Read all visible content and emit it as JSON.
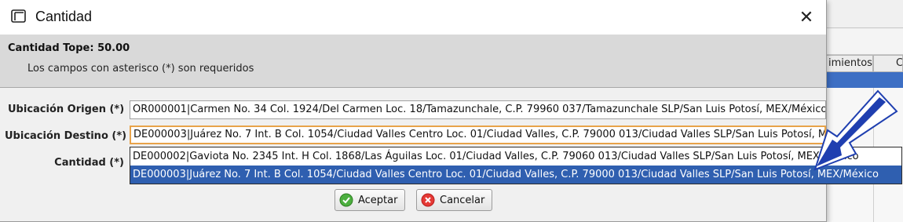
{
  "background_window": {
    "column_headers": [
      "imientos",
      "C"
    ]
  },
  "dialog": {
    "title": "Cantidad",
    "close_label": "✕",
    "header": {
      "cantidad_tope": "Cantidad Tope: 50.00",
      "required_note": "Los campos con asterisco (*) son requeridos"
    },
    "form": {
      "origen_label": "Ubicación Origen (*)",
      "origen_value": "OR000001|Carmen No. 34 Col. 1924/Del Carmen Loc. 18/Tamazunchale, C.P. 79960 037/Tamazunchale SLP/San Luis Potosí, MEX/México",
      "destino_label": "Ubicación Destino (*)",
      "destino_value": "DE000003|Juárez No. 7 Int. B Col. 1054/Ciudad Valles Centro Loc. 01/Ciudad Valles, C.P. 79000 013/Ciudad Valles SLP/San Luis Potosí, MEX/México",
      "cantidad_label": "Cantidad (*)"
    },
    "dropdown_options": [
      "DE000002|Gaviota No. 2345 Int. H Col. 1868/Las Águilas Loc. 01/Ciudad Valles, C.P. 79060 013/Ciudad Valles SLP/San Luis Potosí, MEX/México",
      "DE000003|Juárez No. 7 Int. B Col. 1054/Ciudad Valles Centro Loc. 01/Ciudad Valles, C.P. 79000 013/Ciudad Valles SLP/San Luis Potosí, MEX/México"
    ],
    "selected_option_index": 1,
    "buttons": {
      "aceptar": "Aceptar",
      "cancelar": "Cancelar"
    }
  },
  "colors": {
    "selection_blue": "#2f5fb0",
    "focus_orange": "#e8a34a",
    "arrow_blue": "#1f3fb0"
  }
}
